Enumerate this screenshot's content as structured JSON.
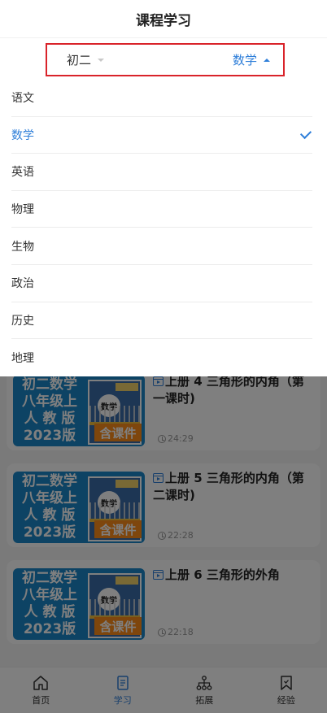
{
  "header": {
    "title": "课程学习"
  },
  "filter": {
    "grade": "初二",
    "subject": "数学"
  },
  "dropdown": {
    "items": [
      {
        "label": "语文",
        "selected": false
      },
      {
        "label": "数学",
        "selected": true
      },
      {
        "label": "英语",
        "selected": false
      },
      {
        "label": "物理",
        "selected": false
      },
      {
        "label": "生物",
        "selected": false
      },
      {
        "label": "政治",
        "selected": false
      },
      {
        "label": "历史",
        "selected": false
      },
      {
        "label": "地理",
        "selected": false
      }
    ]
  },
  "thumbnail": {
    "lines": [
      "初二数学",
      "八年级上",
      "人 教 版",
      "2023版"
    ],
    "book_label": "数学",
    "badge": "含课件"
  },
  "courses": [
    {
      "title": "上册 4 三角形的内角（第一课时)",
      "duration": "24:29"
    },
    {
      "title": "上册 5 三角形的内角（第二课时)",
      "duration": "22:28"
    },
    {
      "title": "上册 6 三角形的外角",
      "duration": "22:18"
    }
  ],
  "bottom_nav": {
    "items": [
      {
        "label": "首页",
        "icon": "home-icon"
      },
      {
        "label": "学习",
        "icon": "document-icon",
        "active": true
      },
      {
        "label": "拓展",
        "icon": "hierarchy-icon"
      },
      {
        "label": "经验",
        "icon": "bookmark-icon"
      }
    ]
  },
  "colors": {
    "accent": "#2f7fd9",
    "highlight_box": "#d9232a",
    "badge": "#fc8c1a"
  }
}
